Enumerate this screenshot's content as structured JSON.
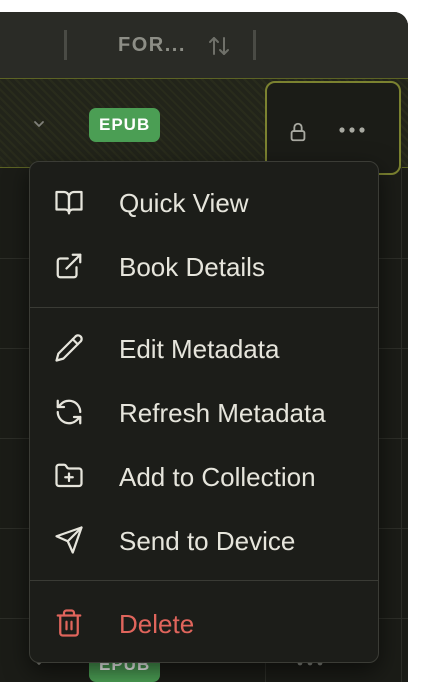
{
  "table": {
    "column_header": "FOR...",
    "rows": [
      {
        "format_badge": "EPUB"
      },
      {
        "format_badge": "EPUB"
      }
    ]
  },
  "menu": {
    "group1": [
      {
        "label": "Quick View",
        "icon": "book-open-icon"
      },
      {
        "label": "Book Details",
        "icon": "external-link-icon"
      }
    ],
    "group2": [
      {
        "label": "Edit Metadata",
        "icon": "pencil-icon"
      },
      {
        "label": "Refresh Metadata",
        "icon": "refresh-icon"
      },
      {
        "label": "Add to Collection",
        "icon": "folder-plus-icon"
      },
      {
        "label": "Send to Device",
        "icon": "send-icon"
      }
    ],
    "danger": {
      "label": "Delete",
      "icon": "trash-icon"
    }
  },
  "colors": {
    "accent": "#7b8230",
    "badge": "#4b9e54",
    "danger": "#e0655c",
    "menu_bg": "#1c1d19"
  }
}
